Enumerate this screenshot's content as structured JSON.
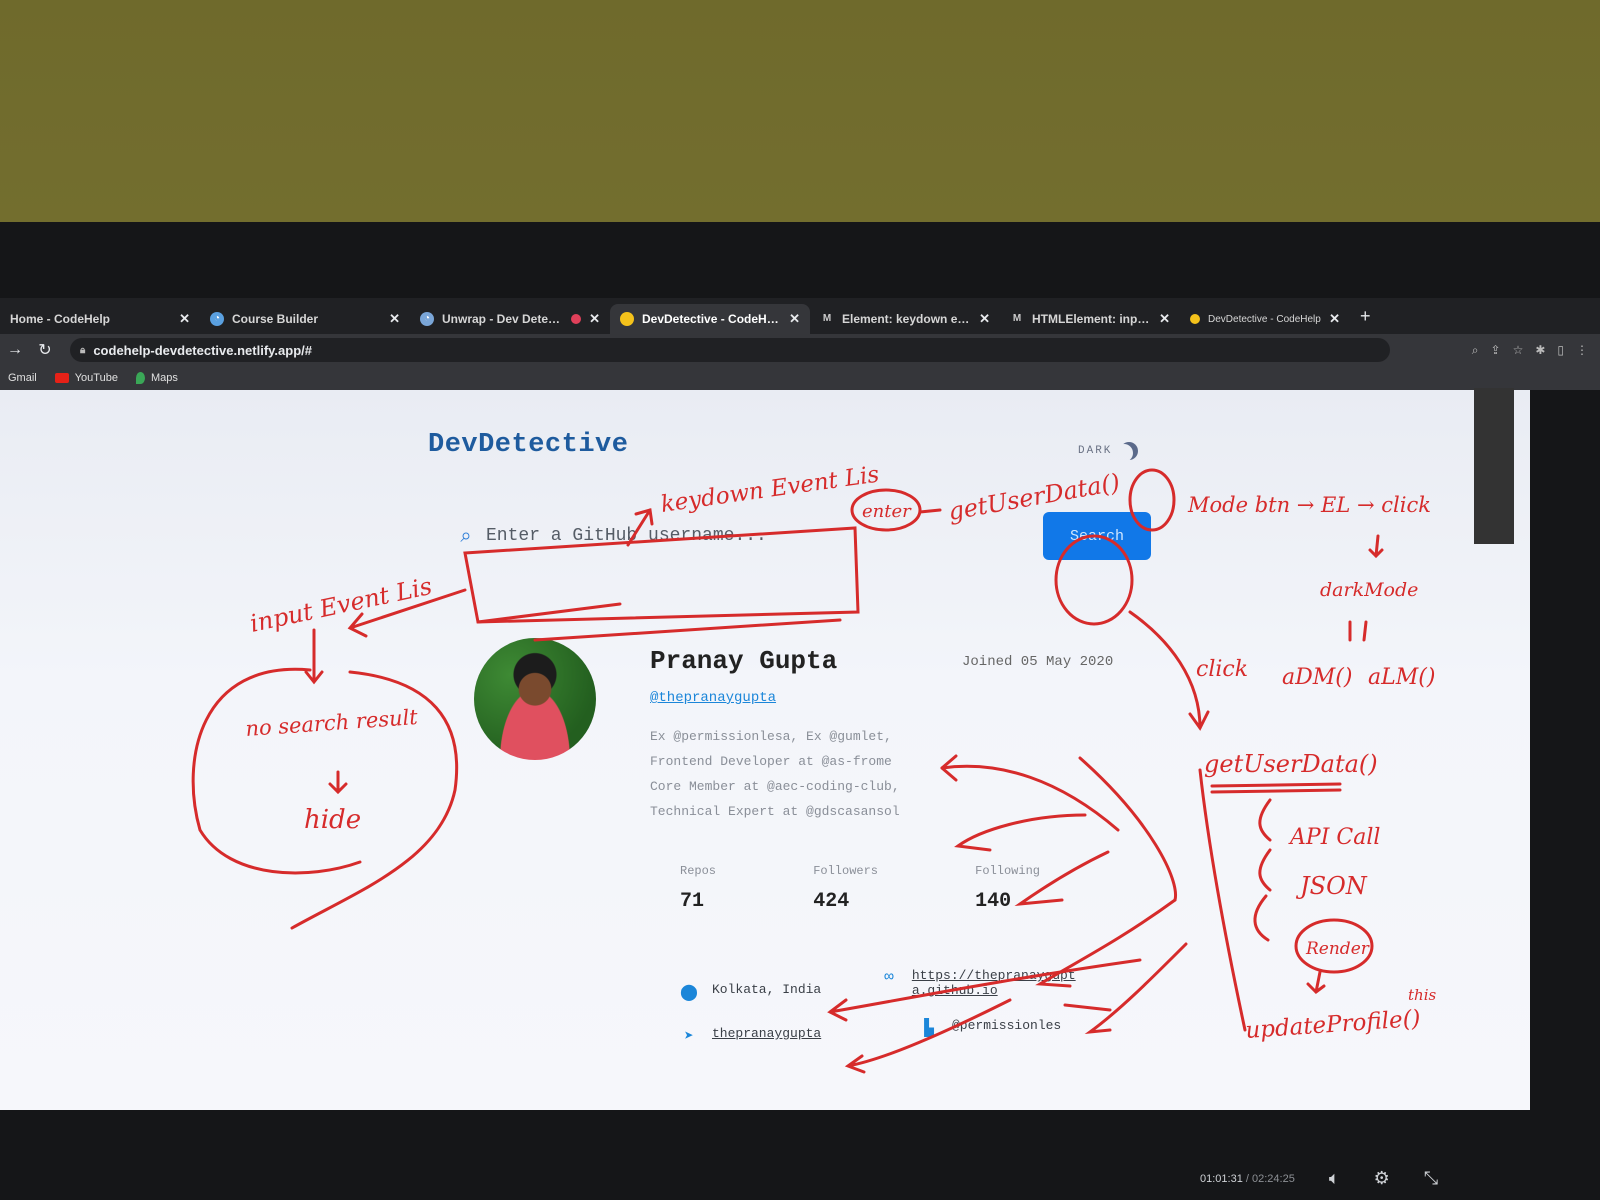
{
  "browser": {
    "tabs": [
      {
        "title": "Home - CodeHelp"
      },
      {
        "title": "Course Builder"
      },
      {
        "title": "Unwrap - Dev Detective F"
      },
      {
        "title": "DevDetective - CodeHelp"
      },
      {
        "title": "Element: keydown event - We"
      },
      {
        "title": "HTMLElement: input event - W"
      },
      {
        "title": "DevDetective - CodeHelp"
      }
    ],
    "active_tab_index": 3,
    "address": "codehelp-devdetective.netlify.app/#",
    "bookmarks": [
      {
        "label": "Gmail"
      },
      {
        "label": "YouTube"
      },
      {
        "label": "Maps"
      }
    ]
  },
  "app": {
    "brand": "DevDetective",
    "mode_label": "DARK",
    "search": {
      "placeholder": "Enter a GitHub username...",
      "button": "Search"
    },
    "profile": {
      "name": "Pranay Gupta",
      "joined": "Joined 05 May 2020",
      "handle": "@thepranaygupta",
      "bio": [
        "Ex @permissionlesa, Ex @gumlet,",
        "Frontend Developer at @as-frome",
        "Core Member at @aec-coding-club,",
        "Technical Expert at @gdscasansol"
      ],
      "stats": [
        {
          "label": "Repos",
          "value": "71"
        },
        {
          "label": "Followers",
          "value": "424"
        },
        {
          "label": "Following",
          "value": "140"
        }
      ],
      "location": "Kolkata, India",
      "website": "https://thepranaygupta.github.io",
      "twitter": "thepranaygupta",
      "company": "@permissionles"
    }
  },
  "video": {
    "current_time": "01:01:31",
    "total_time": "/ 02:24:25"
  },
  "annotations": [
    "keydown Event Lis",
    "enter",
    "getUserData()",
    "Mode btn → EL → click",
    "darkMode",
    "aDM()",
    "aLM()",
    "input Event Lis",
    "no search result",
    "hide",
    "click",
    "getUserData()",
    "API Call",
    "JSON",
    "Render",
    "updateProfile()",
    "this"
  ],
  "colors": {
    "accent": "#1178e8",
    "brand": "#1e5b9e",
    "ink": "#d62b2b"
  }
}
